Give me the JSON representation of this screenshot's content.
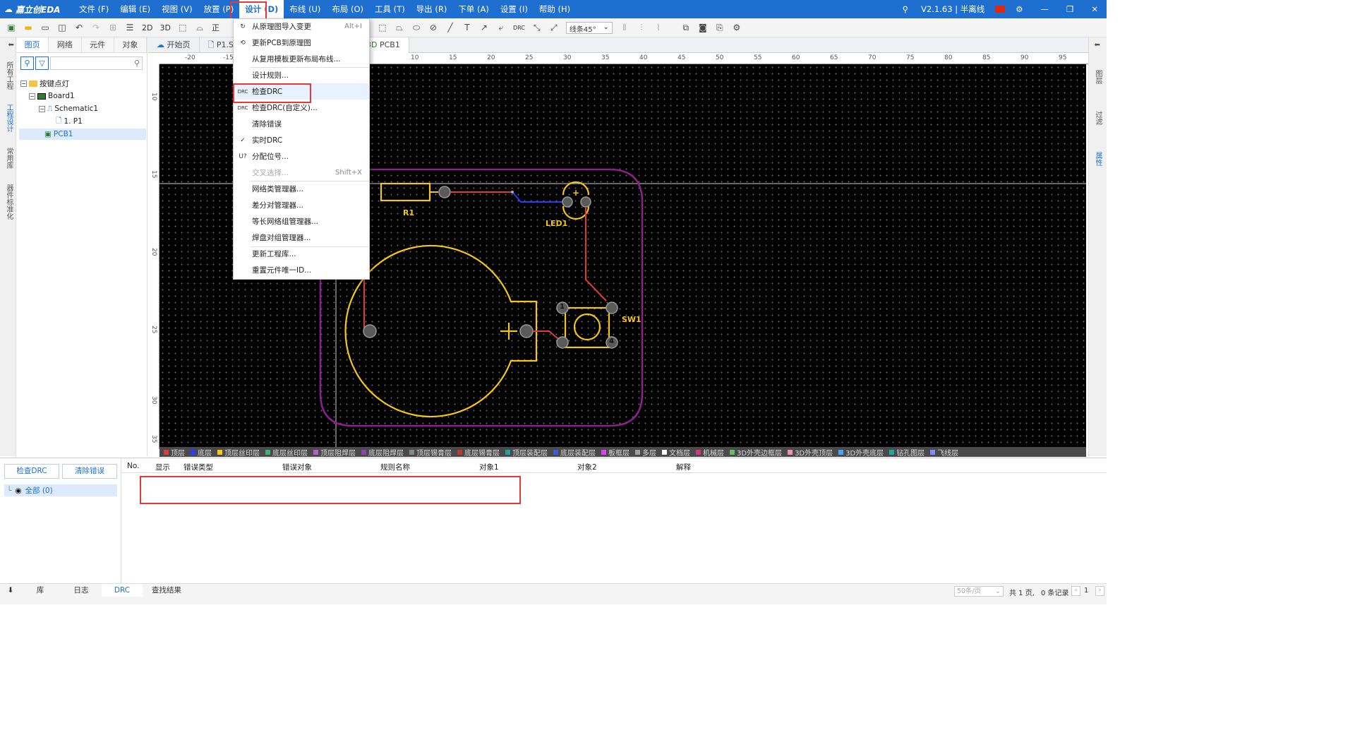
{
  "app": {
    "logo": "嘉立创EDA",
    "version": "V2.1.63 | 半离线"
  },
  "menus": [
    {
      "label": "文件 (F)"
    },
    {
      "label": "编辑 (E)"
    },
    {
      "label": "视图 (V)"
    },
    {
      "label": "放置 (P)"
    },
    {
      "label": "设计 (D)"
    },
    {
      "label": "布线 (U)"
    },
    {
      "label": "布局 (O)"
    },
    {
      "label": "工具 (T)"
    },
    {
      "label": "导出 (R)"
    },
    {
      "label": "下单 (A)"
    },
    {
      "label": "设置 (I)"
    },
    {
      "label": "帮助 (H)"
    }
  ],
  "toolbar": {
    "view2d": "2D",
    "view3d": "3D",
    "partial": "正",
    "drc": "DRC",
    "line_style": "线条45°"
  },
  "left_strip": [
    "所有工程",
    "工程设计",
    "常用库",
    "器件标准化"
  ],
  "left_tabs": [
    "图页",
    "网络",
    "元件",
    "对象"
  ],
  "tree": [
    {
      "label": "按键点灯"
    },
    {
      "label": "Board1"
    },
    {
      "label": "Schematic1"
    },
    {
      "label": "1. P1"
    },
    {
      "label": "PCB1"
    }
  ],
  "doc_tabs": [
    {
      "label": "开始页"
    },
    {
      "label": "P1.Sch"
    },
    {
      "label": "PCB1"
    }
  ],
  "doc_tab_3d": "3D",
  "ruler_top": [
    "-20",
    "-15",
    "10",
    "15",
    "20",
    "25",
    "30",
    "35",
    "40",
    "45",
    "50",
    "55",
    "60",
    "65",
    "70",
    "75",
    "80",
    "85",
    "90",
    "95"
  ],
  "ruler_left": [
    "10",
    "15",
    "20",
    "25",
    "30",
    "35"
  ],
  "dropdown": [
    {
      "label": "从原理图导入变更",
      "shortcut": "Alt+I",
      "icon": "import-icon"
    },
    {
      "label": "更新PCB到原理图",
      "shortcut": "",
      "icon": "update-icon"
    },
    {
      "label": "从复用模板更新布局布线...",
      "shortcut": "",
      "icon": ""
    },
    {
      "label": "设计规则...",
      "shortcut": "",
      "icon": ""
    },
    {
      "label": "检查DRC",
      "shortcut": "",
      "icon": "DRC"
    },
    {
      "label": "检查DRC(自定义)...",
      "shortcut": "",
      "icon": "DRC"
    },
    {
      "label": "清除错误",
      "shortcut": "",
      "icon": ""
    },
    {
      "label": "实时DRC",
      "shortcut": "",
      "icon": "✓"
    },
    {
      "label": "分配位号...",
      "shortcut": "",
      "icon": "U?"
    },
    {
      "label": "交叉选择...",
      "shortcut": "Shift+X",
      "icon": ""
    },
    {
      "label": "网络类管理器...",
      "shortcut": "",
      "icon": ""
    },
    {
      "label": "差分对管理器...",
      "shortcut": "",
      "icon": ""
    },
    {
      "label": "等长网络组管理器...",
      "shortcut": "",
      "icon": ""
    },
    {
      "label": "焊盘对组管理器...",
      "shortcut": "",
      "icon": ""
    },
    {
      "label": "更新工程库...",
      "shortcut": "",
      "icon": ""
    },
    {
      "label": "重置元件唯一ID...",
      "shortcut": "",
      "icon": ""
    }
  ],
  "pcb": {
    "r1": "R1",
    "led1": "LED1",
    "sw1": "SW1",
    "pin1": "1",
    "pin4": "4"
  },
  "layers": [
    {
      "name": "顶层",
      "color": "#e53935"
    },
    {
      "name": "底层",
      "color": "#2a3aff"
    },
    {
      "name": "顶层丝印层",
      "color": "#f5c518"
    },
    {
      "name": "底层丝印层",
      "color": "#3cb371"
    },
    {
      "name": "顶层阻焊层",
      "color": "#b45fcf"
    },
    {
      "name": "底层阻焊层",
      "color": "#8e44ad"
    },
    {
      "name": "顶层锡膏层",
      "color": "#7f8c8d"
    },
    {
      "name": "底层锡膏层",
      "color": "#c0392b"
    },
    {
      "name": "顶层装配层",
      "color": "#2aa198"
    },
    {
      "name": "底层装配层",
      "color": "#3b5bdb"
    },
    {
      "name": "板框层",
      "color": "#e040fb"
    },
    {
      "name": "多层",
      "color": "#9e9e9e"
    },
    {
      "name": "文档层",
      "color": "#ffffff"
    },
    {
      "name": "机械层",
      "color": "#d63384"
    },
    {
      "name": "3D外壳边框层",
      "color": "#66bb6a"
    },
    {
      "name": "3D外壳顶层",
      "color": "#f48fb1"
    },
    {
      "name": "3D外壳底层",
      "color": "#42a5f5"
    },
    {
      "name": "钻孔图层",
      "color": "#26a69a"
    },
    {
      "name": "飞线层",
      "color": "#7e8cff"
    }
  ],
  "right_strip": [
    "图层",
    "过滤",
    "属性"
  ],
  "bottom": {
    "check_drc": "检查DRC",
    "clear_errors": "清除错误",
    "all_label": "全部 (0)",
    "columns": [
      "No.",
      "显示",
      "错误类型",
      "错误对象",
      "规则名称",
      "对象1",
      "对象2",
      "解释"
    ]
  },
  "status_tabs": [
    "库",
    "日志",
    "DRC",
    "查找结果"
  ],
  "pagination": {
    "per_page": "50条/页",
    "pages": "共 1 页,",
    "records": "0 条记录",
    "page_number": "1"
  },
  "colors": {
    "accent": "#1f6fd1",
    "highlight": "#e53935",
    "silkscreen": "#f5c518",
    "board_outline": "#8e1f8e"
  }
}
